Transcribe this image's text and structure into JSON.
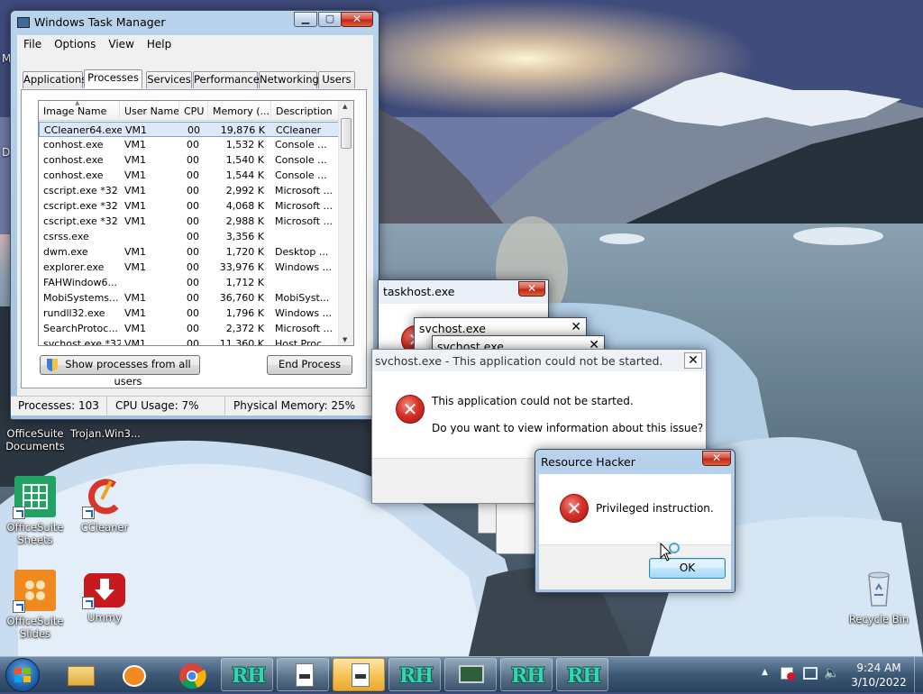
{
  "desktop": {
    "icons": [
      {
        "label": "OfficeSuite Documents"
      },
      {
        "label": "Trojan.Win3..."
      },
      {
        "label": "OfficeSuite Sheets"
      },
      {
        "label": "CCleaner"
      },
      {
        "label": "OfficeSuite Slides"
      },
      {
        "label": "Ummy"
      },
      {
        "label": "Recycle Bin"
      }
    ],
    "edge_labels": [
      "M",
      "D"
    ]
  },
  "task_manager": {
    "title": "Windows Task Manager",
    "menu": [
      "File",
      "Options",
      "View",
      "Help"
    ],
    "tabs": [
      "Applications",
      "Processes",
      "Services",
      "Performance",
      "Networking",
      "Users"
    ],
    "active_tab": "Processes",
    "columns": [
      "Image Name",
      "User Name",
      "CPU",
      "Memory (...",
      "Description"
    ],
    "rows": [
      {
        "image": "CCleaner64.exe",
        "user": "VM1",
        "cpu": "00",
        "mem": "19,876 K",
        "desc": "CCleaner"
      },
      {
        "image": "conhost.exe",
        "user": "VM1",
        "cpu": "00",
        "mem": "1,532 K",
        "desc": "Console ..."
      },
      {
        "image": "conhost.exe",
        "user": "VM1",
        "cpu": "00",
        "mem": "1,540 K",
        "desc": "Console ..."
      },
      {
        "image": "conhost.exe",
        "user": "VM1",
        "cpu": "00",
        "mem": "1,544 K",
        "desc": "Console ..."
      },
      {
        "image": "cscript.exe *32",
        "user": "VM1",
        "cpu": "00",
        "mem": "2,992 K",
        "desc": "Microsoft ..."
      },
      {
        "image": "cscript.exe *32",
        "user": "VM1",
        "cpu": "00",
        "mem": "4,068 K",
        "desc": "Microsoft ..."
      },
      {
        "image": "cscript.exe *32",
        "user": "VM1",
        "cpu": "00",
        "mem": "2,988 K",
        "desc": "Microsoft ..."
      },
      {
        "image": "csrss.exe",
        "user": "",
        "cpu": "00",
        "mem": "3,356 K",
        "desc": ""
      },
      {
        "image": "dwm.exe",
        "user": "VM1",
        "cpu": "00",
        "mem": "1,720 K",
        "desc": "Desktop ..."
      },
      {
        "image": "explorer.exe",
        "user": "VM1",
        "cpu": "00",
        "mem": "33,976 K",
        "desc": "Windows ..."
      },
      {
        "image": "FAHWindow6...",
        "user": "",
        "cpu": "00",
        "mem": "1,712 K",
        "desc": ""
      },
      {
        "image": "MobiSystems...",
        "user": "VM1",
        "cpu": "00",
        "mem": "36,760 K",
        "desc": "MobiSyst..."
      },
      {
        "image": "rundll32.exe",
        "user": "VM1",
        "cpu": "00",
        "mem": "1,796 K",
        "desc": "Windows ..."
      },
      {
        "image": "SearchProtoc...",
        "user": "VM1",
        "cpu": "00",
        "mem": "2,372 K",
        "desc": "Microsoft ..."
      },
      {
        "image": "svchost.exe *32",
        "user": "VM1",
        "cpu": "00",
        "mem": "11,360 K",
        "desc": "Host Proc..."
      }
    ],
    "show_all_label": "Show processes from all users",
    "end_process_label": "End Process",
    "status": {
      "processes": "Processes: 103",
      "cpu": "CPU Usage: 7%",
      "memory": "Physical Memory: 25%"
    }
  },
  "taskhost_dialog": {
    "title": "taskhost.exe"
  },
  "svchost_dialog1": {
    "title": "svchost.exe"
  },
  "svchost_dialog2": {
    "title": "svchost.exe"
  },
  "svchost_error": {
    "title": "svchost.exe - This application could not be started.",
    "message": "This application could not be started.",
    "question": "Do you want to view information about this issue?"
  },
  "resource_hacker": {
    "title": "Resource Hacker",
    "message": "Privileged instruction.",
    "ok_label": "OK"
  },
  "taskbar": {
    "rh_label": "RH",
    "clock_time": "9:24 AM",
    "clock_date": "3/10/2022"
  }
}
